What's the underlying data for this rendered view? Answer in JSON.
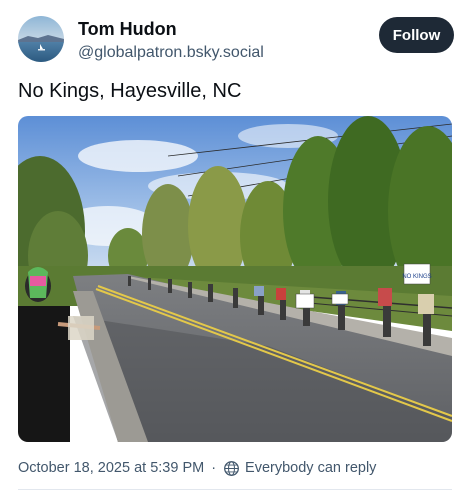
{
  "author": {
    "display_name": "Tom Hudon",
    "handle": "@globalpatron.bsky.social",
    "avatar_icon": "avatar-lake-icon"
  },
  "follow_button": {
    "label": "Follow"
  },
  "post": {
    "text": "No Kings, Hayesville, NC",
    "image": {
      "sign_text": "NO KINGS"
    }
  },
  "footer": {
    "timestamp": "October 18, 2025 at 5:39 PM",
    "reply_icon": "globe-icon",
    "reply_setting": "Everybody can reply"
  },
  "colors": {
    "primary_text": "#0b0f14",
    "secondary_text": "#42576c",
    "button_bg": "#1e2936",
    "button_text": "#ffffff"
  }
}
